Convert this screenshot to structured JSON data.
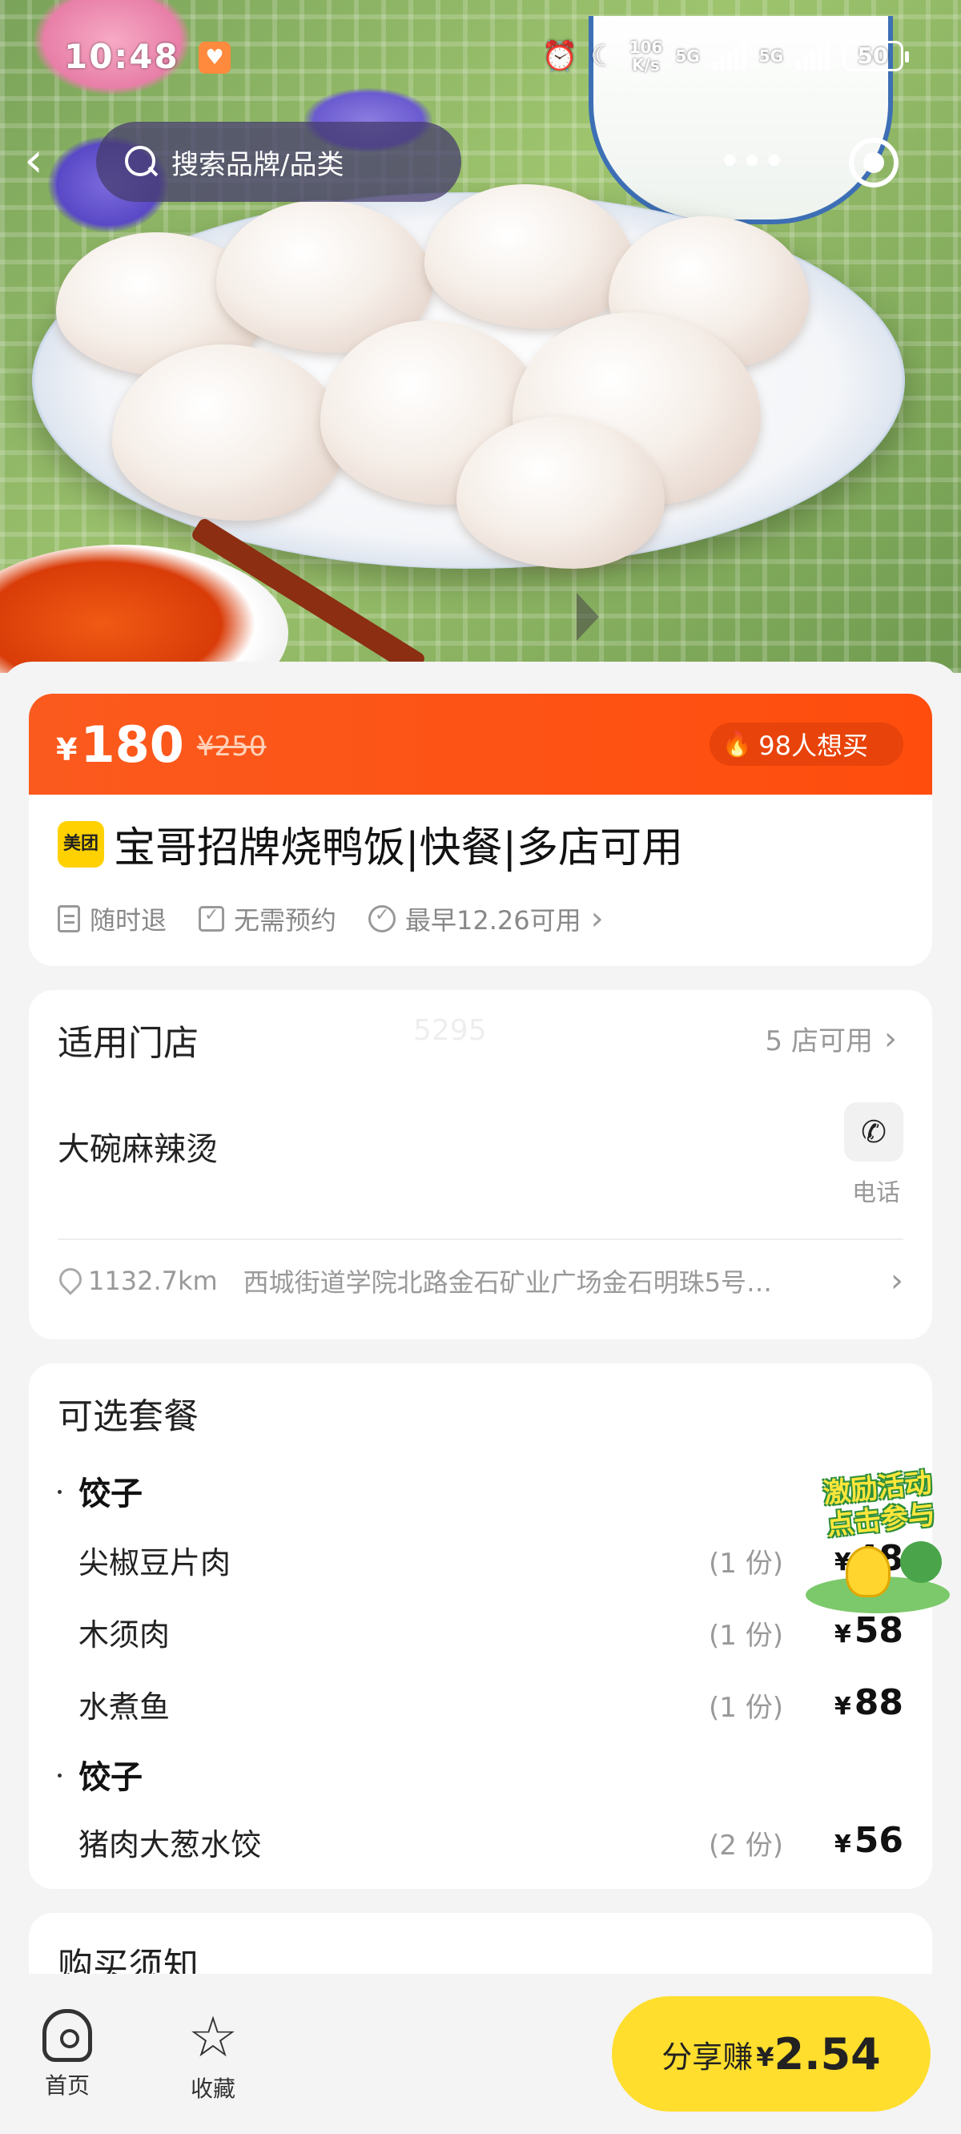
{
  "status_bar": {
    "time": "10:48",
    "net_speed_top": "106",
    "net_speed_unit": "K/s",
    "sim1": "5G",
    "sim2": "5G",
    "battery": "50"
  },
  "top_nav": {
    "search_placeholder": "搜索品牌/品类",
    "more_label": "•••"
  },
  "deal": {
    "currency": "¥",
    "price": "180",
    "original_price": "¥250",
    "want_count": "98人想买",
    "brand_badge": "美团",
    "title": "宝哥招牌烧鸭饭|快餐|多店可用",
    "tags": [
      "随时退",
      "无需预约",
      "最早12.26可用"
    ]
  },
  "stores": {
    "title": "适用门店",
    "watermark": "5295",
    "count_label": "5 店可用",
    "store_name": "大碗麻辣烫",
    "phone_label": "电话",
    "distance": "1132.7km",
    "address": "西城街道学院北路金石矿业广场金石明珠5号…"
  },
  "menu": {
    "title": "可选套餐",
    "groups": [
      {
        "name": "饺子",
        "items": [
          {
            "name": "尖椒豆片肉",
            "qty": "(1 份)",
            "price": "48"
          },
          {
            "name": "木须肉",
            "qty": "(1 份)",
            "price": "58"
          },
          {
            "name": "水煮鱼",
            "qty": "(1 份)",
            "price": "88"
          }
        ]
      },
      {
        "name": "饺子",
        "items": [
          {
            "name": "猪肉大葱水饺",
            "qty": "(2 份)",
            "price": "56"
          }
        ]
      }
    ]
  },
  "promo": {
    "line1": "激励活动",
    "line2": "点击参与"
  },
  "notice": {
    "title": "购买须知"
  },
  "bottom_bar": {
    "home_label": "首页",
    "fav_label": "收藏",
    "share_label": "分享赚",
    "share_currency": "¥",
    "share_amount": "2.54"
  }
}
